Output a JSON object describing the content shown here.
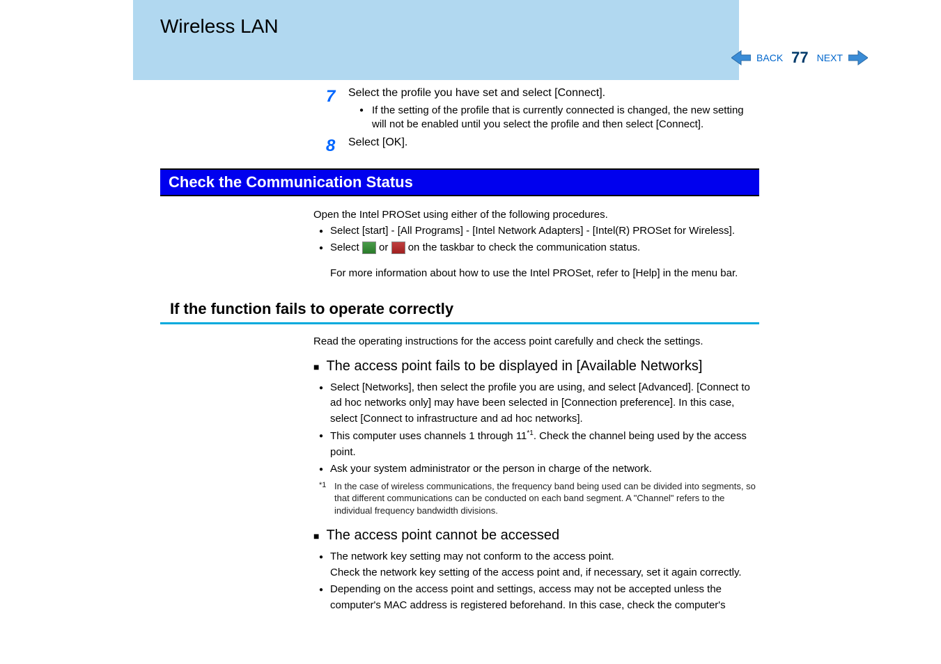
{
  "header": {
    "title": "Wireless LAN"
  },
  "nav": {
    "back": "BACK",
    "page": "77",
    "next": "NEXT"
  },
  "steps": {
    "s7": {
      "num": "7",
      "text": "Select the profile you have set and select [Connect].",
      "bullet": "If the setting of the profile that is currently connected is changed, the new setting will not be enabled until you select the profile and then select [Connect]."
    },
    "s8": {
      "num": "8",
      "text": "Select [OK]."
    }
  },
  "section1": {
    "title": "Check the Communication Status",
    "intro": "Open the Intel PROSet using either of the following procedures.",
    "b1": "Select [start] - [All Programs] - [Intel Network Adapters] - [Intel(R) PROSet for Wireless].",
    "b2_a": "Select ",
    "b2_b": " or ",
    "b2_c": " on the taskbar to check the communication status.",
    "more": "For more information about how to use the Intel PROSet, refer to [Help] in the menu bar."
  },
  "subsection": {
    "title": "If the function fails to operate correctly",
    "intro": "Read the operating instructions for the access point carefully and check the settings."
  },
  "sq1": {
    "title": "The access point fails to be displayed in [Available Networks]",
    "b1": "Select [Networks], then select the profile you are using, and select [Advanced]. [Connect to ad hoc networks only] may have been selected in [Connection preference].   In this case, select [Connect to infrastructure and ad hoc networks].",
    "b2_a": "This computer uses channels 1 through 11",
    "b2_b": ".  Check the channel being used by the access point.",
    "b3": "Ask your system administrator or the person in charge of the network.",
    "fn_mark": "*1",
    "fn": "In the case of wireless communications, the frequency band being used can be divided into segments, so that different communications can be conducted on each band segment.  A \"Channel\" refers to the individual frequency bandwidth divisions."
  },
  "sq2": {
    "title": "The access point cannot be accessed",
    "b1": "The network key setting may not conform to the access point.",
    "b1b": "Check the network key setting of the access point and, if necessary, set it again correctly.",
    "b2": "Depending on the access point and settings, access may not be accepted unless the computer's MAC address is registered beforehand.   In this case, check the computer's"
  }
}
